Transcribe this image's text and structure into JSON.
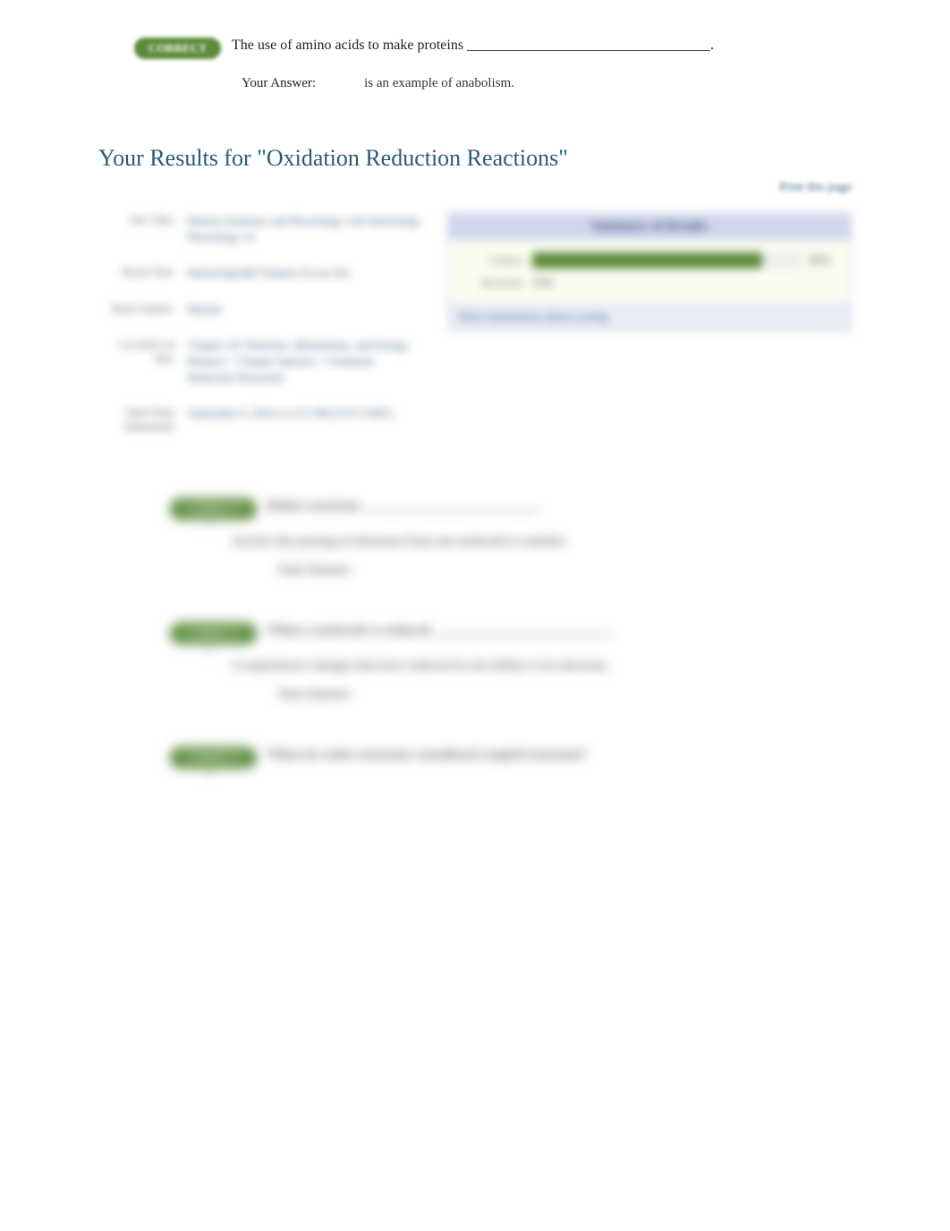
{
  "top_question": {
    "badge": "CORRECT",
    "text": "The use of amino acids to make proteins __________________________________.",
    "answer_label": "Your Answer:",
    "answer_value": "is an example of anabolism."
  },
  "results": {
    "title": "Your Results for \"Oxidation Reduction Reactions\"",
    "print_link": "Print this page"
  },
  "meta": {
    "site_title_label": "Site Title:",
    "site_title_value": "Human Anatomy and Physiology with Interesting Physiology 10",
    "book_title_label": "Book Title:",
    "book_title_value": "MasteringA&P Student Access Kit",
    "book_author_label": "Book Author:",
    "book_author_value": "Marieb",
    "location_label": "Location on Site:",
    "location_value": "Chapter 24: Nutrition, Metabolism, and Energy Balance > Chapter Quizzes > Oxidation Reduction Reactions",
    "date_label": "Date/Time Submitted:",
    "date_value": "September 6, 2016 at 4:31 PM (UTC/GMT)"
  },
  "summary": {
    "header": "Summary of Results",
    "correct_label": "Correct",
    "correct_pct": "85%",
    "incorrect_label": "Incorrect",
    "incorrect_pct": "15%",
    "footer_link": "More information about scoring"
  },
  "questions": [
    {
      "num": "1",
      "badge": "CORRECT",
      "text": "Redox reactions ________________________.",
      "answer_label": "Your Answer:",
      "answer_value": "involve the passing of electrons from one molecule to another."
    },
    {
      "num": "2",
      "badge": "CORRECT",
      "text": "When a molecule is reduced, ________________________.",
      "answer_label": "Your Answer:",
      "answer_value": "it experiences changes that have reduced its net ability to its electrons."
    },
    {
      "num": "3",
      "badge": "CORRECT",
      "text": "What are redox reactions considered coupled reactions?",
      "answer_label": "",
      "answer_value": ""
    }
  ]
}
